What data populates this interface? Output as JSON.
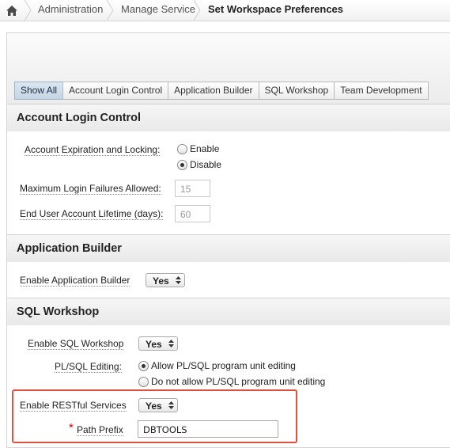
{
  "breadcrumb": {
    "items": [
      "Administration",
      "Manage Service"
    ],
    "current": "Set Workspace Preferences"
  },
  "tabs": [
    {
      "label": "Show All",
      "active": true
    },
    {
      "label": "Account Login Control",
      "active": false
    },
    {
      "label": "Application Builder",
      "active": false
    },
    {
      "label": "SQL Workshop",
      "active": false
    },
    {
      "label": "Team Development",
      "active": false
    }
  ],
  "account_login": {
    "title": "Account Login Control",
    "expiration_label": "Account Expiration and Locking:",
    "expiration_options": [
      {
        "label": "Enable",
        "selected": false
      },
      {
        "label": "Disable",
        "selected": true
      }
    ],
    "max_failures_label": "Maximum Login Failures Allowed:",
    "max_failures_value": "15",
    "lifetime_label": "End User Account Lifetime (days):",
    "lifetime_value": "60"
  },
  "app_builder": {
    "title": "Application Builder",
    "enable_label": "Enable Application Builder",
    "enable_value": "Yes"
  },
  "sql_workshop": {
    "title": "SQL Workshop",
    "enable_label": "Enable SQL Workshop",
    "enable_value": "Yes",
    "plsql_label": "PL/SQL Editing:",
    "plsql_options": [
      {
        "label": "Allow PL/SQL program unit editing",
        "selected": true
      },
      {
        "label": "Do not allow PL/SQL program unit editing",
        "selected": false
      }
    ],
    "restful_label": "Enable RESTful Services",
    "restful_value": "Yes",
    "required_marker": "*",
    "path_prefix_label": "Path Prefix",
    "path_prefix_value": "DBTOOLS"
  },
  "colors": {
    "highlight": "#e0523f",
    "required": "#dd0000",
    "active_tab": "#c6d5e5"
  }
}
